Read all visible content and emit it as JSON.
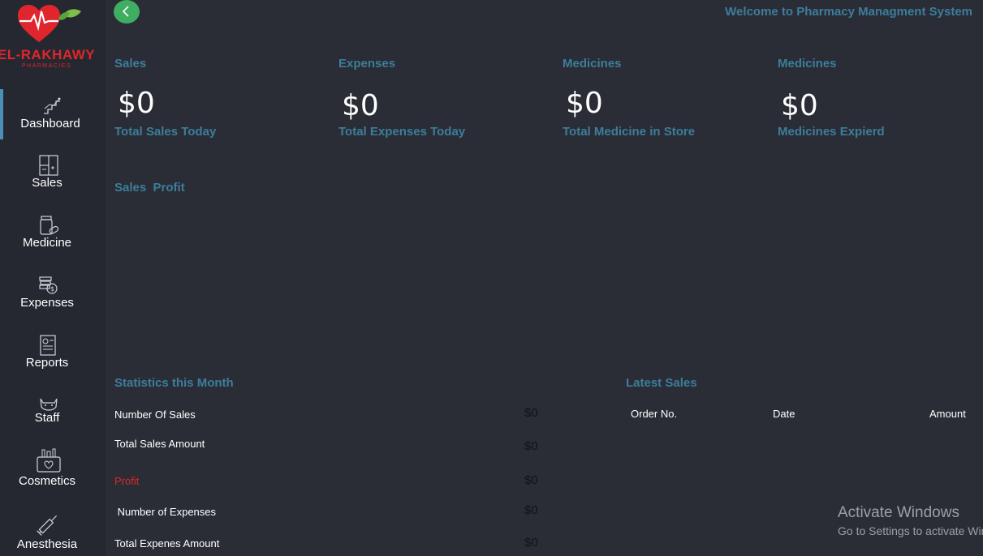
{
  "brand": {
    "name": "EL-RAKHAWY",
    "subtitle": "PHARMACIES"
  },
  "header": {
    "welcome": "Welcome to Pharmacy Managment System"
  },
  "sidebar": {
    "items": [
      {
        "label": "Dashboard",
        "icon": "chart-stairs-icon",
        "active": true
      },
      {
        "label": "Sales",
        "icon": "register-icon"
      },
      {
        "label": "Medicine",
        "icon": "pill-bottle-icon"
      },
      {
        "label": "Expenses",
        "icon": "coins-icon"
      },
      {
        "label": "Reports",
        "icon": "report-icon"
      },
      {
        "label": "Staff",
        "icon": "cat-icon"
      },
      {
        "label": "Cosmetics",
        "icon": "cosmetics-bag-icon"
      },
      {
        "label": "Anesthesia",
        "icon": "syringe-icon"
      }
    ]
  },
  "cards": [
    {
      "title": "Sales",
      "value": "$0",
      "subtitle": "Total Sales Today"
    },
    {
      "title": "Expenses",
      "value": "$0",
      "subtitle": "Total Expenses Today"
    },
    {
      "title": "Medicines",
      "value": "$0",
      "subtitle": "Total Medicine in Store"
    },
    {
      "title": "Medicines",
      "value": "$0",
      "subtitle": "Medicines Expierd"
    }
  ],
  "sales_profit": {
    "title": "Sales  Profit"
  },
  "statistics": {
    "title": "Statistics this Month",
    "rows": [
      {
        "label": "Number Of Sales",
        "value": "$0"
      },
      {
        "label": "Total Sales Amount",
        "value": "$0"
      },
      {
        "label": "Profit",
        "value": "$0"
      },
      {
        "label": " Number of Expenses",
        "value": "$0"
      },
      {
        "label": "Total Expenes Amount",
        "value": "$0"
      }
    ]
  },
  "latest_sales": {
    "title": "Latest Sales",
    "columns": [
      "Order No.",
      "Date",
      "Amount"
    ]
  },
  "watermark": {
    "title": "Activate Windows",
    "subtitle": "Go to Settings to activate Windows."
  },
  "colors": {
    "accent": "#3d7d9b",
    "brand_red": "#e0262c",
    "back_button": "#3fae62",
    "background": "#2a2d36"
  }
}
